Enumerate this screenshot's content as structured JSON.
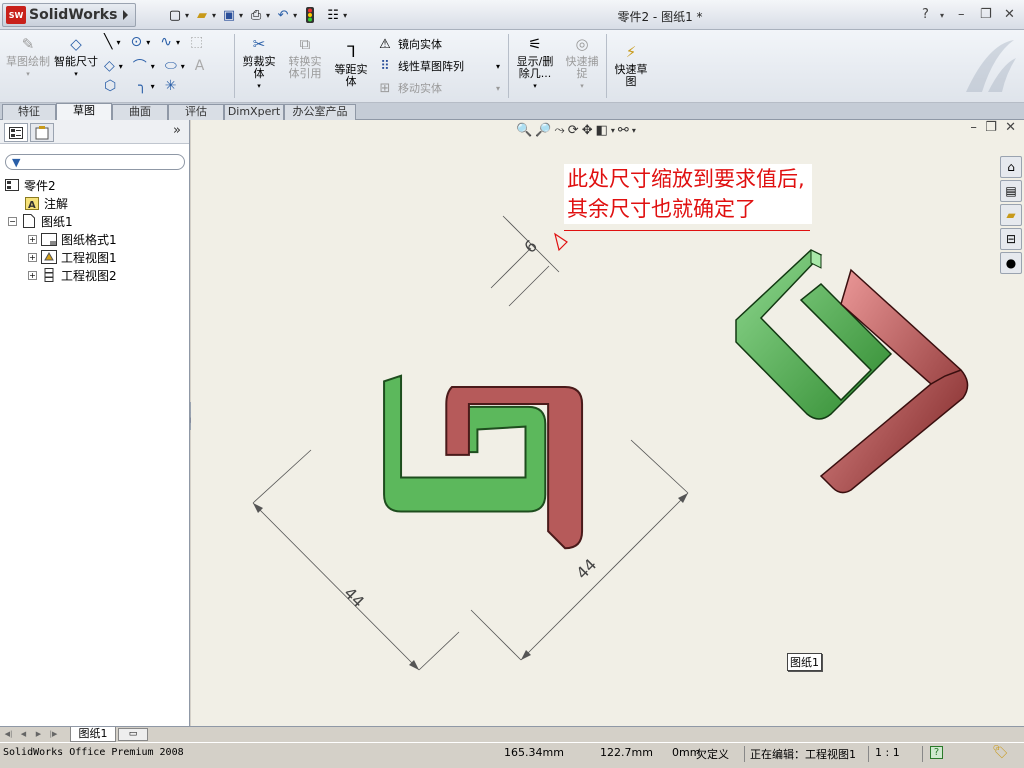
{
  "app": {
    "logo_text": "SolidWorks",
    "document_title": "零件2 - 图纸1 *",
    "help": "?"
  },
  "ribbon": {
    "sketch_draw": "草图绘制",
    "smart_dimension": "智能尺寸",
    "trim_entities": "剪裁实体",
    "convert_entities": "转换实体引用",
    "offset_entities": "等距实体",
    "mirror_entities": "镜向实体",
    "linear_pattern": "线性草图阵列",
    "move_entities": "移动实体",
    "display_delete": "显示/删除几...",
    "quick_snaps": "快速捕捉",
    "rapid_sketch": "快速草图"
  },
  "tabs": [
    {
      "label": "特征"
    },
    {
      "label": "草图"
    },
    {
      "label": "曲面"
    },
    {
      "label": "评估"
    },
    {
      "label": "DimXpert"
    },
    {
      "label": "办公室产品"
    }
  ],
  "tree": {
    "root": "零件2",
    "annotations": "注解",
    "sheet": "图纸1",
    "sheet_format": "图纸格式1",
    "view1": "工程视图1",
    "view2": "工程视图2"
  },
  "canvas": {
    "annotation_note": "此处尺寸缩放到要求值后,其余尺寸也就确定了",
    "dim_small": "6",
    "dim_left": "44",
    "dim_right": "44",
    "sheet_label": "图纸1"
  },
  "sheet_tab": "图纸1",
  "status": {
    "product": "SolidWorks Office Premium 2008",
    "x": "165.34mm",
    "y": "122.7mm",
    "z": "0mm",
    "define_state": "欠定义",
    "editing": "正在编辑：工程视图1",
    "scale": "1 : 1"
  },
  "colors": {
    "green": "#5cb85c",
    "red": "#b65a5a",
    "note_red": "#e01010"
  }
}
